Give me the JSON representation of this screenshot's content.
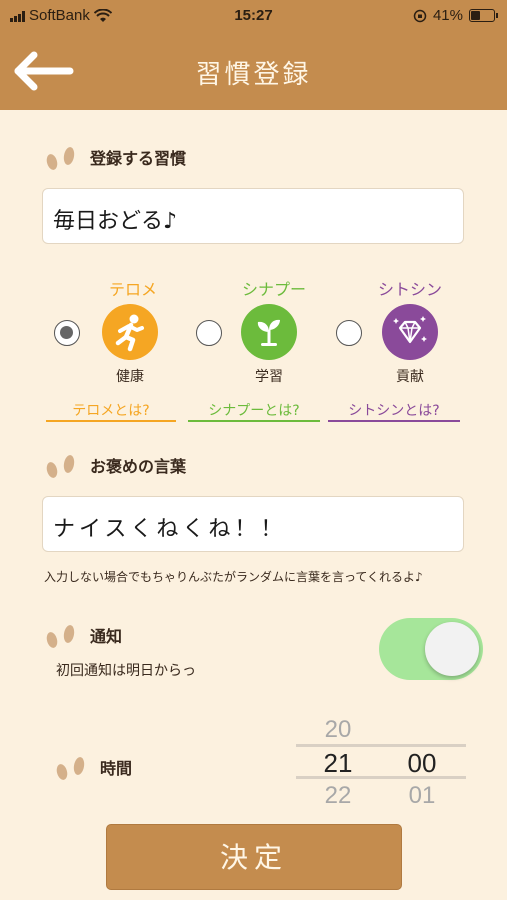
{
  "status_bar": {
    "carrier": "SoftBank",
    "time": "15:27",
    "battery": "41%",
    "battery_level": 0.41
  },
  "nav": {
    "title": "習慣登録",
    "back_icon": "left-arrow-icon"
  },
  "habit": {
    "label": "登録する習慣",
    "value": "毎日おどる♪"
  },
  "categories": [
    {
      "name": "テロメ",
      "sub": "健康",
      "link": "テロメとは?",
      "color": "#f5a623",
      "icon": "running-person-icon",
      "selected": true
    },
    {
      "name": "シナプー",
      "sub": "学習",
      "link": "シナプーとは?",
      "color": "#6cbb3c",
      "icon": "sprout-icon",
      "selected": false
    },
    {
      "name": "シトシン",
      "sub": "貢献",
      "link": "シトシンとは?",
      "color": "#8a4a9a",
      "icon": "diamond-icon",
      "selected": false
    }
  ],
  "praise": {
    "label": "お褒めの言葉",
    "value": "ナイスくねくね！！",
    "hint": "入力しない場合でもちゃりんぶたがランダムに言葉を言ってくれるよ♪"
  },
  "notification": {
    "label": "通知",
    "sub": "初回通知は明日からっ",
    "enabled": true
  },
  "time": {
    "label": "時間",
    "hours": [
      "20",
      "21",
      "22"
    ],
    "minutes": [
      "",
      "00",
      "01"
    ]
  },
  "submit_label": "決定",
  "colors": {
    "brand": "#c48c4e",
    "background": "#fcf1df",
    "toggle_on": "#a6e69a"
  }
}
